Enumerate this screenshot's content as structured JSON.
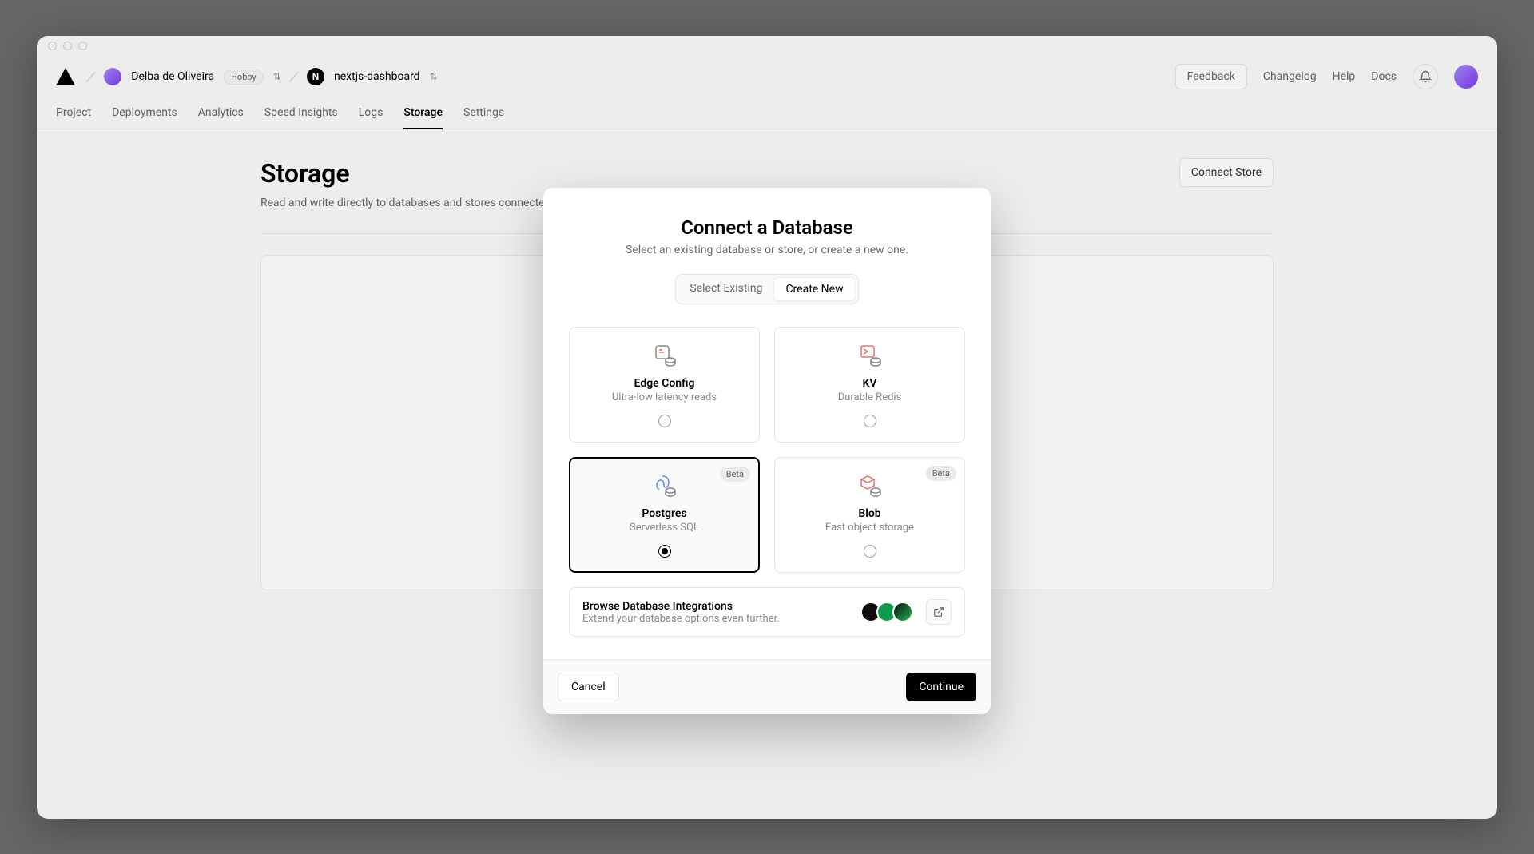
{
  "header": {
    "user_name": "Delba de Oliveira",
    "user_plan": "Hobby",
    "project_name": "nextjs-dashboard",
    "feedback": "Feedback",
    "links": [
      "Changelog",
      "Help",
      "Docs"
    ]
  },
  "tabs": [
    "Project",
    "Deployments",
    "Analytics",
    "Speed Insights",
    "Logs",
    "Storage",
    "Settings"
  ],
  "active_tab": "Storage",
  "page": {
    "title": "Storage",
    "subtitle": "Read and write directly to databases and stores connected to your project.",
    "connect_store": "Connect Store"
  },
  "modal": {
    "title": "Connect a Database",
    "subtitle": "Select an existing database or store, or create a new one.",
    "segmented": {
      "select_existing": "Select Existing",
      "create_new": "Create New"
    },
    "active_segment": "Create New",
    "options": {
      "edge_config": {
        "title": "Edge Config",
        "desc": "Ultra-low latency reads"
      },
      "kv": {
        "title": "KV",
        "desc": "Durable Redis"
      },
      "postgres": {
        "title": "Postgres",
        "desc": "Serverless SQL",
        "badge": "Beta"
      },
      "blob": {
        "title": "Blob",
        "desc": "Fast object storage",
        "badge": "Beta"
      }
    },
    "selected_option": "postgres",
    "integrations": {
      "title": "Browse Database Integrations",
      "desc": "Extend your database options even further."
    },
    "cancel": "Cancel",
    "continue": "Continue"
  }
}
